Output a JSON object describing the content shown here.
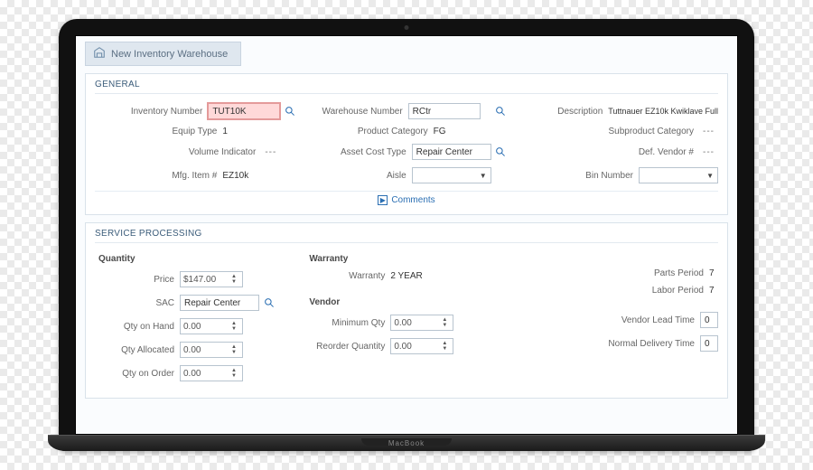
{
  "title": "New Inventory Warehouse",
  "g": {
    "header": "GENERAL",
    "inv_lbl": "Inventory Number",
    "inv": "TUT10K",
    "wh_lbl": "Warehouse Number",
    "wh": "RCtr",
    "desc_lbl": "Description",
    "desc": "Tuttnauer EZ10k Kwiklave Full",
    "eq_lbl": "Equip Type",
    "eq": "1",
    "pc_lbl": "Product Category",
    "pc": "FG",
    "spc_lbl": "Subproduct Category",
    "spc": "---",
    "vi_lbl": "Volume Indicator",
    "vi": "---",
    "act_lbl": "Asset Cost Type",
    "act": "Repair Center",
    "dv_lbl": "Def. Vendor #",
    "dv": "---",
    "mfg_lbl": "Mfg. Item #",
    "mfg": "EZ10k",
    "aisle_lbl": "Aisle",
    "aisle": "",
    "bin_lbl": "Bin Number",
    "bin": "",
    "comments": "Comments"
  },
  "s": {
    "header": "SERVICE PROCESSING",
    "qty_hdr": "Quantity",
    "price_lbl": "Price",
    "price": "$147.00",
    "sac_lbl": "SAC",
    "sac": "Repair Center",
    "qoh_lbl": "Qty on Hand",
    "qoh": "0.00",
    "qal_lbl": "Qty Allocated",
    "qal": "0.00",
    "qoo_lbl": "Qty on Order",
    "qoo": "0.00",
    "war_hdr": "Warranty",
    "war_lbl": "Warranty",
    "war": "2 YEAR",
    "ven_hdr": "Vendor",
    "minq_lbl": "Minimum Qty",
    "minq": "0.00",
    "roq_lbl": "Reorder Quantity",
    "roq": "0.00",
    "pp_lbl": "Parts Period",
    "pp": "7",
    "lp_lbl": "Labor Period",
    "lp": "7",
    "vlt_lbl": "Vendor Lead Time",
    "vlt": "0",
    "ndt_lbl": "Normal Delivery Time",
    "ndt": "0"
  }
}
